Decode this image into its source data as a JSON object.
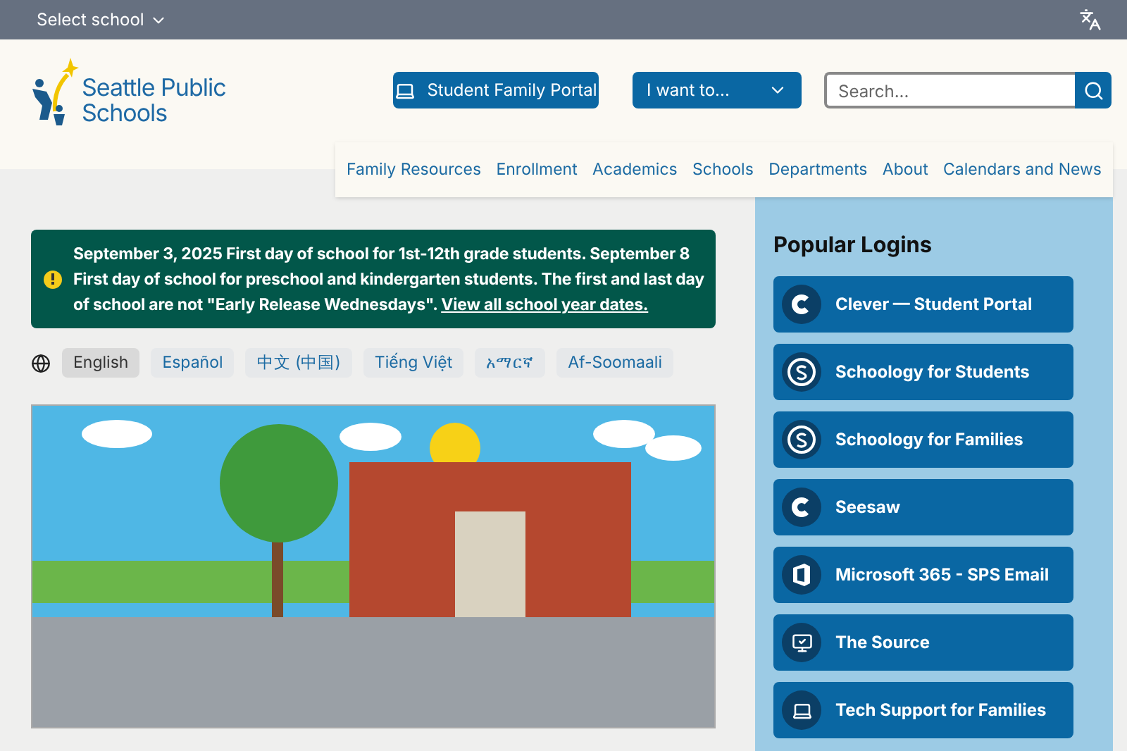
{
  "top_bar": {
    "school_select": "Select school"
  },
  "header": {
    "logo_text": [
      "Seattle Public",
      "Schools"
    ],
    "portal_button": "Student Family Portal",
    "menu_button": "I want to...",
    "search": {
      "placeholder": "Search..."
    }
  },
  "nav": [
    "Family Resources",
    "Enrollment",
    "Academics",
    "Schools",
    "Departments",
    "About",
    "Calendars and News"
  ],
  "alert": {
    "text": "September 3, 2025 First day of school for 1st-12th grade students. September 8 First day of school for preschool and kindergarten students. The first and last day of school are not \"Early Release Wednesdays\".",
    "link": "View all school year dates."
  },
  "languages": [
    {
      "label": "English",
      "selected": true
    },
    {
      "label": "Español",
      "selected": false
    },
    {
      "label": "中文 (中国)",
      "selected": false
    },
    {
      "label": "Tiếng Việt",
      "selected": false
    },
    {
      "label": "አማርኛ",
      "selected": false
    },
    {
      "label": "Af-Soomaali",
      "selected": false
    }
  ],
  "popular_logins": {
    "title": "Popular Logins",
    "items": [
      {
        "label": "Clever — Student Portal",
        "kind": "c"
      },
      {
        "label": "Schoology for Students",
        "kind": "s"
      },
      {
        "label": "Schoology for Families",
        "kind": "s"
      },
      {
        "label": "Seesaw",
        "kind": "c"
      },
      {
        "label": "Microsoft 365 - SPS Email",
        "kind": "office"
      },
      {
        "label": "The Source",
        "kind": "monitor"
      },
      {
        "label": "Tech Support for Families",
        "kind": "laptop"
      }
    ]
  }
}
